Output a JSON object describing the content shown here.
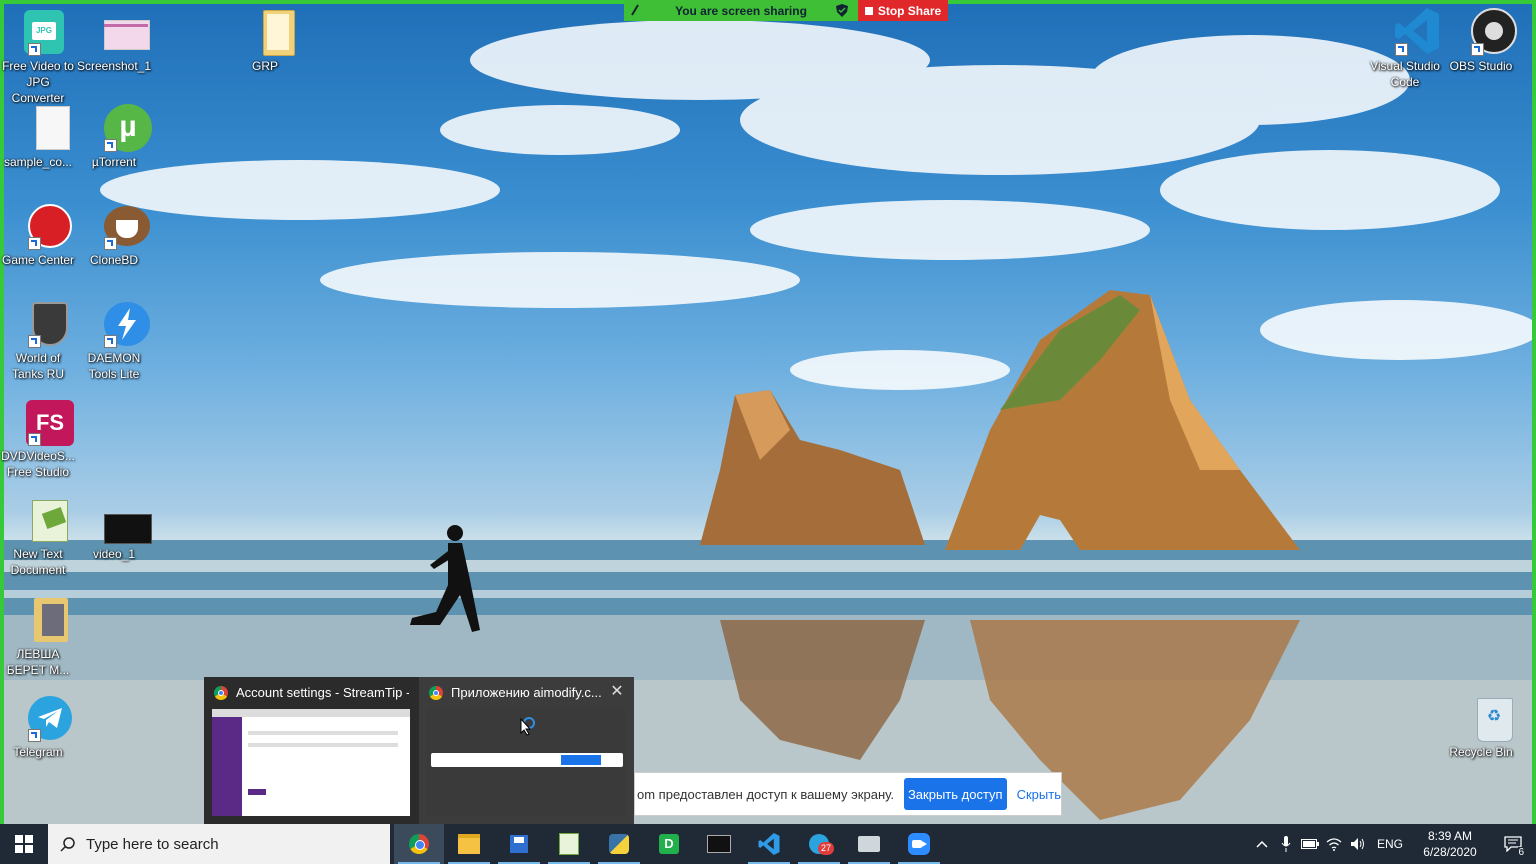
{
  "share_bar": {
    "status": "You are screen sharing",
    "stop_label": "Stop Share"
  },
  "desktop_icons": [
    {
      "label": "Free Video to JPG Converter",
      "icon": "jpg-converter-icon"
    },
    {
      "label": "Screenshot_1",
      "icon": "image-file-icon"
    },
    {
      "label": "GRP",
      "icon": "folder-icon"
    },
    {
      "label": "sample_co...",
      "icon": "blank-file-icon"
    },
    {
      "label": "µTorrent",
      "icon": "utorrent-icon"
    },
    {
      "label": "Game Center",
      "icon": "game-center-icon"
    },
    {
      "label": "CloneBD",
      "icon": "clonebd-icon"
    },
    {
      "label": "World of Tanks RU",
      "icon": "world-of-tanks-icon"
    },
    {
      "label": "DAEMON Tools Lite",
      "icon": "daemon-tools-icon"
    },
    {
      "label": "DVDVideoS... Free Studio",
      "icon": "dvdvideosoft-icon"
    },
    {
      "label": "New Text Document",
      "icon": "text-document-icon"
    },
    {
      "label": "video_1",
      "icon": "video-file-icon"
    },
    {
      "label": "ЛЕВША БЕРЕТ М...",
      "icon": "book-folder-icon"
    },
    {
      "label": "Telegram",
      "icon": "telegram-icon"
    },
    {
      "label": "Visual Studio Code",
      "icon": "vscode-icon"
    },
    {
      "label": "OBS Studio",
      "icon": "obs-icon"
    },
    {
      "label": "Recycle Bin",
      "icon": "recycle-bin-icon"
    }
  ],
  "thumbnails": [
    {
      "title": "Account settings - StreamTip - ..."
    },
    {
      "title": "Приложению aimodify.c..."
    }
  ],
  "notification": {
    "message": "om предоставлен доступ к вашему экрану.",
    "close_access": "Закрыть доступ",
    "hide": "Скрыть"
  },
  "taskbar": {
    "search_placeholder": "Type here to search",
    "telegram_badge": "27",
    "apps": [
      "chrome-icon",
      "file-explorer-icon",
      "save-disk-icon",
      "notepad-icon",
      "python-icon",
      "d-app-icon",
      "terminal-icon",
      "vscode-icon",
      "telegram-icon",
      "printer-icon",
      "zoom-icon"
    ]
  },
  "tray": {
    "language": "ENG",
    "time": "8:39 AM",
    "date": "6/28/2020",
    "notification_count": "6"
  },
  "colors": {
    "share_green": "#3fbf35",
    "stop_red": "#e0282a",
    "taskbar_bg": "#1f2a36",
    "accent_blue": "#1a73e8"
  }
}
